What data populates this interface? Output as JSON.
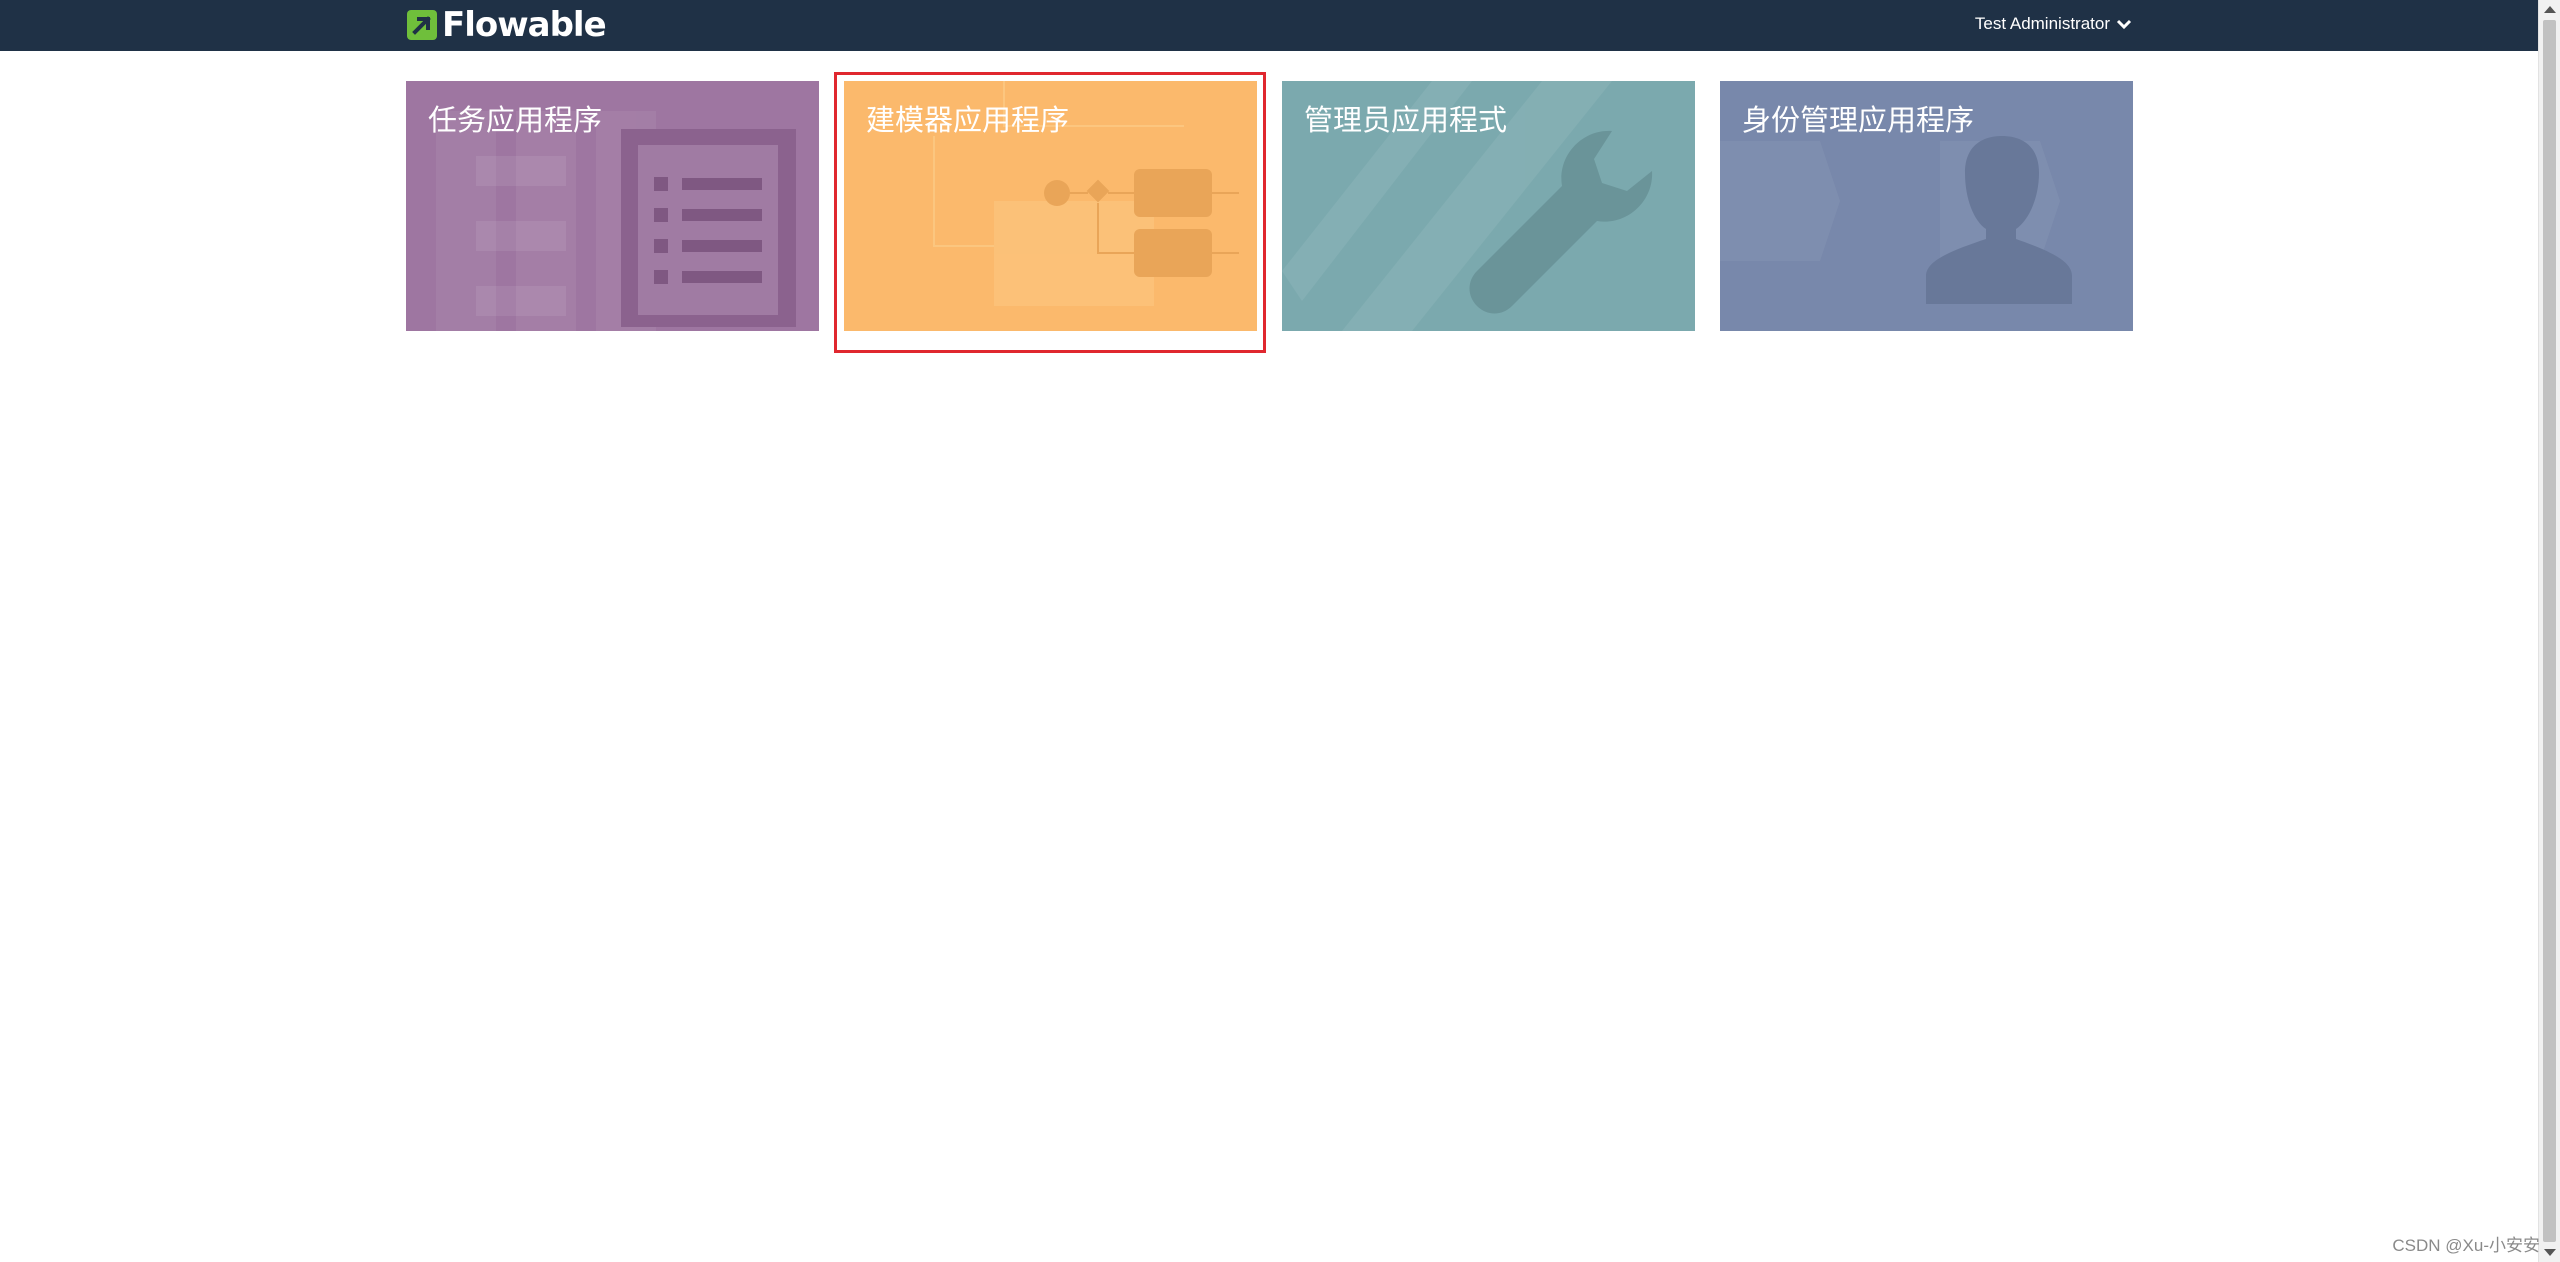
{
  "header": {
    "logo_text": "Flowable",
    "logo_icon": "flowable-arrow-icon",
    "user_name": "Test Administrator",
    "user_menu_icon": "chevron-down-icon"
  },
  "apps": [
    {
      "title": "任务应用程序",
      "color": "#9e76a1",
      "icon": "task-list-icon"
    },
    {
      "title": "建模器应用程序",
      "color": "#fbb96c",
      "icon": "process-diagram-icon"
    },
    {
      "title": "管理员应用程式",
      "color": "#7ba9ae",
      "icon": "wrench-icon"
    },
    {
      "title": "身份管理应用程序",
      "color": "#7888ab",
      "icon": "user-silhouette-icon"
    }
  ],
  "highlight_color": "#e0272f",
  "watermark": "CSDN @Xu-小安安"
}
